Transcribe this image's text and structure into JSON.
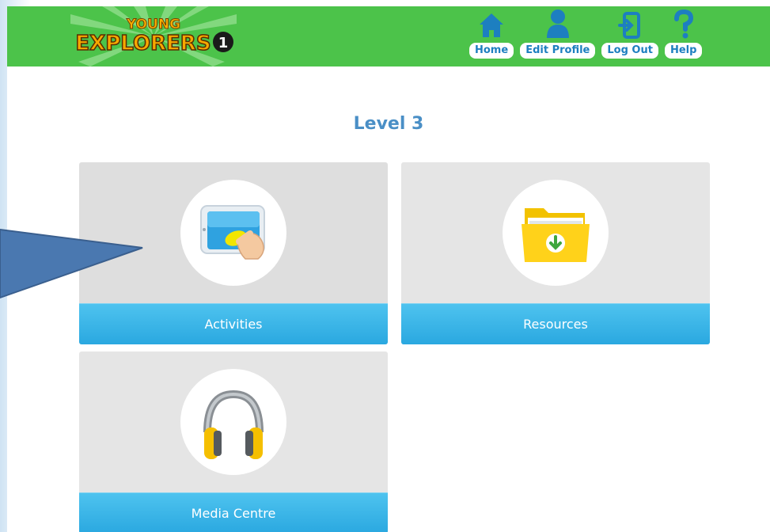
{
  "header": {
    "logo_top": "YOUNG",
    "logo_main": "EXPLORERS",
    "logo_num": "1",
    "nav": [
      {
        "label": "Home",
        "icon": "home-icon"
      },
      {
        "label": "Edit Profile",
        "icon": "profile-icon"
      },
      {
        "label": "Log Out",
        "icon": "logout-icon"
      },
      {
        "label": "Help",
        "icon": "help-icon"
      }
    ]
  },
  "main": {
    "title": "Level 3",
    "tiles": [
      {
        "label": "Activities",
        "icon": "tablet-touch-icon"
      },
      {
        "label": "Resources",
        "icon": "folder-download-icon"
      },
      {
        "label": "Media Centre",
        "icon": "headphones-icon"
      }
    ]
  },
  "colors": {
    "header": "#4cc34a",
    "tile_bar": "#2aa8e0",
    "title": "#4a8fc6",
    "nav_icon": "#1d7fc0",
    "arrow": "#4a78b0"
  }
}
